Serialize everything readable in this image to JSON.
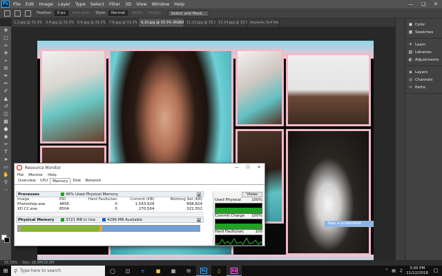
{
  "app": {
    "logo": "Ps"
  },
  "menu": [
    "File",
    "Edit",
    "Image",
    "Layer",
    "Type",
    "Select",
    "Filter",
    "3D",
    "View",
    "Window",
    "Help"
  ],
  "options": {
    "feather_label": "Feather:",
    "feather_value": "0 px",
    "antialias_label": "Anti-alias",
    "style_label": "Style:",
    "style_value": "Normal",
    "width_label": "Width:",
    "height_label": "Height:",
    "select_mask_label": "Select and Mask..."
  },
  "tabs": [
    "1.2.jpg @ 33.3% (R...",
    "3.4.jpg @ 33.3% (R...",
    "5.6.jpg @ 33.3% (R...",
    "7.8.jpg @ 33.3% (R...",
    "9,10.jpg @ 33.3% (RGB/8)",
    "11.12.jpg @ 33.3% (R...",
    "13.14.jpg @ 33.3% (R...",
    "bayaulio 3x4 feet2.psd"
  ],
  "panels": {
    "group1": [
      {
        "icon": "color-icon",
        "label": "Color"
      },
      {
        "icon": "swatches-icon",
        "label": "Swatches"
      }
    ],
    "group2": [
      {
        "icon": "learn-icon",
        "label": "Learn"
      },
      {
        "icon": "libraries-icon",
        "label": "Libraries"
      },
      {
        "icon": "adjustments-icon",
        "label": "Adjustments"
      }
    ],
    "group3": [
      {
        "icon": "layers-icon",
        "label": "Layers"
      },
      {
        "icon": "channels-icon",
        "label": "Channels"
      },
      {
        "icon": "paths-icon",
        "label": "Paths"
      }
    ]
  },
  "status": {
    "zoom": "33.33%",
    "doc": "Doc: 18.3M/18.3M"
  },
  "resource_monitor": {
    "title": "Resource Monitor",
    "menu": [
      "File",
      "Monitor",
      "Help"
    ],
    "tabs": [
      "Overview",
      "CPU",
      "Memory",
      "Disk",
      "Network"
    ],
    "active_tab": "Memory",
    "processes": {
      "title": "Processes",
      "summary": "45% Used Physical Memory",
      "columns": [
        "Image",
        "PID",
        "Hard Faults/sec",
        "Commit (KB)",
        "Working Set (KB)"
      ],
      "rows": [
        [
          "Photoshop.exe",
          "4456",
          "0",
          "1,543,928",
          "898,824"
        ],
        [
          "XD CC.exe",
          "8504",
          "0",
          "270,504",
          "321,552"
        ]
      ]
    },
    "physical_memory": {
      "title": "Physical Memory",
      "in_use": "3721 MB In Use",
      "available": "4296 MB Available"
    },
    "views_label": "Views",
    "graphs": [
      {
        "label": "Used Physical Memory",
        "value": "100%"
      },
      {
        "label": "Commit Charge",
        "value": "100%"
      },
      {
        "label": "Hard Faults/sec",
        "value": "100"
      }
    ]
  },
  "tooltip": "Take a screenshot",
  "taskbar": {
    "search_placeholder": "Type here to search",
    "apps": [
      "Ps",
      "Xd"
    ],
    "clock_time": "3:00 PM",
    "clock_date": "11/12/2018"
  },
  "colors": {
    "ps_bg": "#535353",
    "frame_pink": "#f2b8c6",
    "accent_blue": "#31a8ff",
    "taskbar": "#101010"
  }
}
